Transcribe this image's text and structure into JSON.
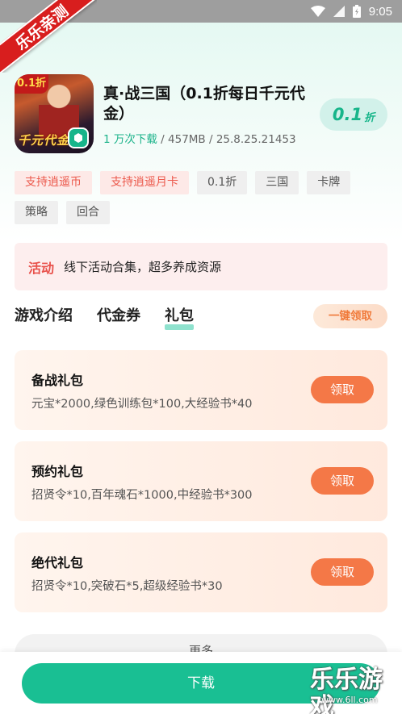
{
  "status_bar": {
    "time": "9:05"
  },
  "ribbon": {
    "text": "乐乐亲测"
  },
  "game": {
    "icon_badge": "0.1折",
    "icon_text": "千元代金",
    "title": "真·战三国（0.1折每日千元代金）",
    "downloads": "1 万次下载",
    "meta_rest": " / 457MB / 25.8.25.21453",
    "discount_value": "0.1",
    "discount_unit": "折"
  },
  "tags": [
    {
      "label": "支持逍遥币",
      "style": "red"
    },
    {
      "label": "支持逍遥月卡",
      "style": "red"
    },
    {
      "label": "0.1折",
      "style": "gray"
    },
    {
      "label": "三国",
      "style": "gray"
    },
    {
      "label": "卡牌",
      "style": "gray"
    },
    {
      "label": "策略",
      "style": "gray"
    },
    {
      "label": "回合",
      "style": "gray"
    }
  ],
  "activity": {
    "label": "活动",
    "text": "线下活动合集，超多养成资源"
  },
  "tabs": [
    {
      "label": "游戏介绍",
      "active": false
    },
    {
      "label": "代金券",
      "active": false
    },
    {
      "label": "礼包",
      "active": true
    }
  ],
  "claim_all_label": "一键领取",
  "gifts": [
    {
      "title": "备战礼包",
      "desc": "元宝*2000,绿色训练包*100,大经验书*40",
      "button": "领取"
    },
    {
      "title": "预约礼包",
      "desc": "招贤令*10,百年魂石*1000,中经验书*300",
      "button": "领取"
    },
    {
      "title": "绝代礼包",
      "desc": "招贤令*10,突破石*5,超级经验书*30",
      "button": "领取"
    }
  ],
  "more_label": "更多",
  "download_label": "下载",
  "watermark": {
    "text": "乐乐游戏",
    "url": "www.6ll.com"
  },
  "colors": {
    "accent_green": "#19bf93",
    "gift_button": "#f47847",
    "activity_red": "#e8514b"
  }
}
